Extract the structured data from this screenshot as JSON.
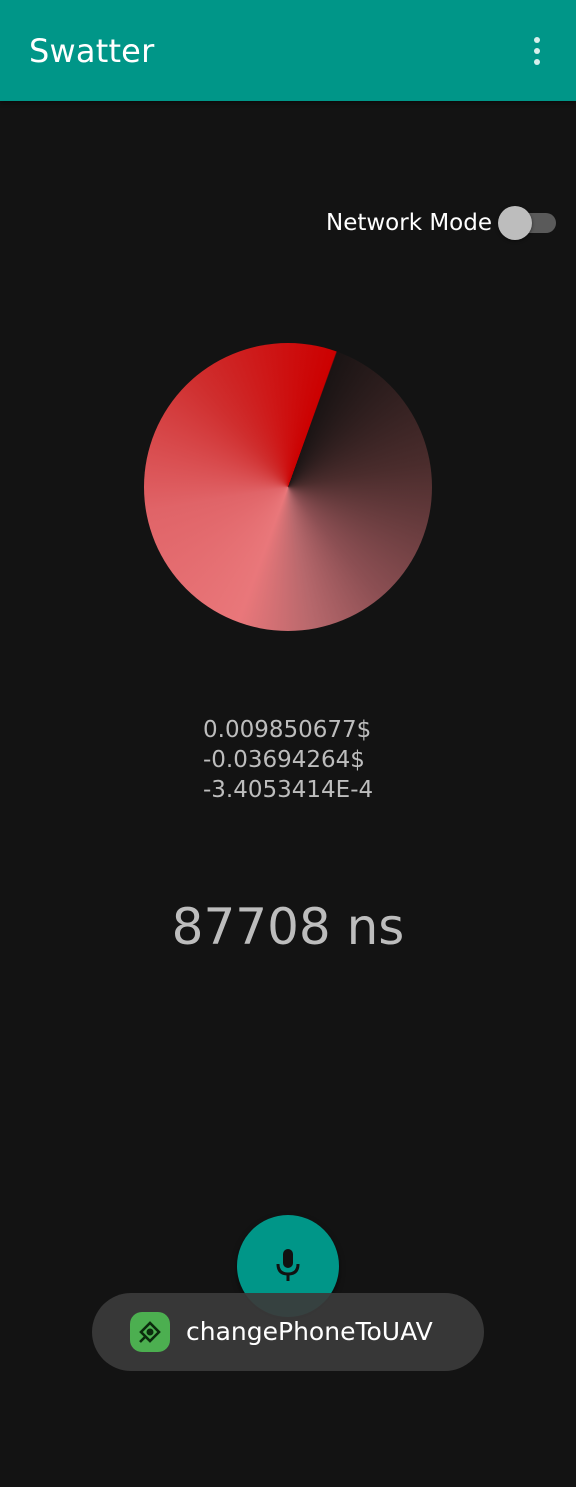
{
  "app": {
    "title": "Swatter",
    "overflow_icon": "more-vert-icon"
  },
  "network_mode": {
    "label": "Network Mode",
    "enabled": false
  },
  "dial": {
    "colors": {
      "dark": "#1a1414",
      "light": "#e9777a",
      "bright": "#cc0000"
    }
  },
  "readings": {
    "values": [
      "0.009850677$",
      "-0.03694264$",
      "-3.4053414E-4"
    ],
    "timing": "87708 ns"
  },
  "fab": {
    "icon": "microphone-icon",
    "color": "#009688"
  },
  "toast": {
    "icon": "app-icon",
    "text": "changePhoneToUAV"
  }
}
